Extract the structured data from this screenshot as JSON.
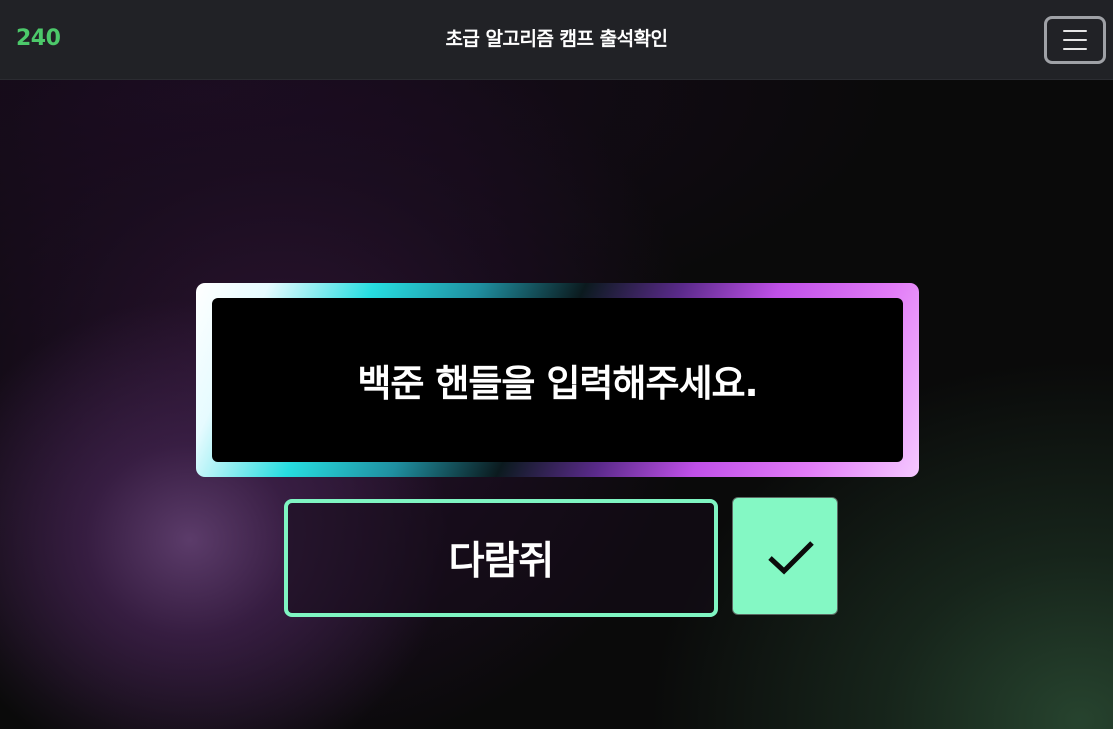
{
  "header": {
    "logo": "240",
    "title": "초급 알고리즘 캠프 출석확인",
    "menu_icon": "hamburger-menu-icon"
  },
  "main": {
    "prompt": "백준 핸들을 입력해주세요.",
    "handle_input": {
      "value": "다람쥐"
    },
    "submit_icon": "checkmark-icon"
  },
  "colors": {
    "logo": "#4cc96a",
    "accent": "#84f8c4",
    "header_bg": "#212226"
  }
}
